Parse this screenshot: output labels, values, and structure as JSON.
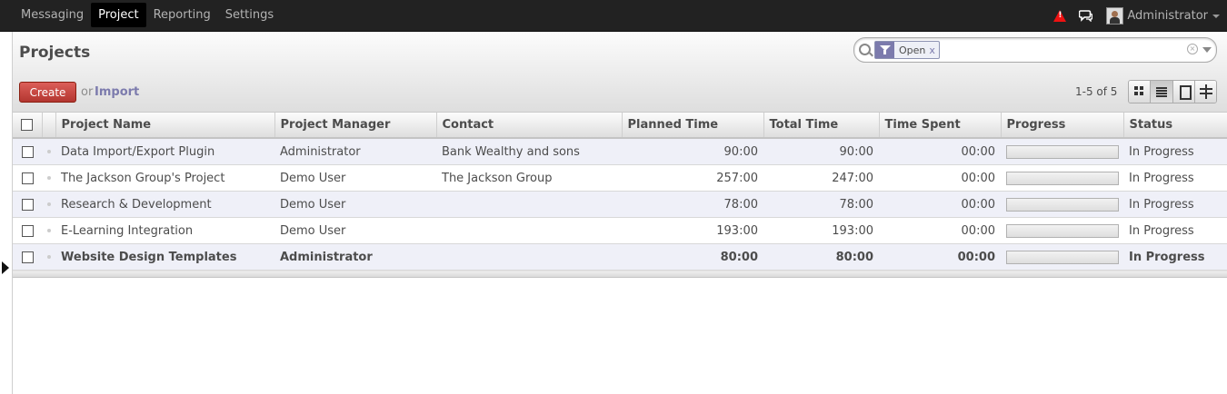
{
  "topbar": {
    "menu": [
      "Messaging",
      "Project",
      "Reporting",
      "Settings"
    ],
    "active_menu": "Project",
    "user": "Administrator"
  },
  "control_panel": {
    "title": "Projects",
    "search": {
      "facet_value": "Open",
      "facet_remove": "x"
    },
    "create_label": "Create",
    "or_label": "or",
    "import_label": "Import",
    "pager": "1-5 of 5"
  },
  "table": {
    "columns": [
      "Project Name",
      "Project Manager",
      "Contact",
      "Planned Time",
      "Total Time",
      "Time Spent",
      "Progress",
      "Status"
    ],
    "rows": [
      {
        "name": "Data Import/Export Plugin",
        "manager": "Administrator",
        "contact": "Bank Wealthy and sons",
        "planned": "90:00",
        "total": "90:00",
        "spent": "00:00",
        "progress": 0,
        "status": "In Progress"
      },
      {
        "name": "The Jackson Group's Project",
        "manager": "Demo User",
        "contact": "The Jackson Group",
        "planned": "257:00",
        "total": "247:00",
        "spent": "00:00",
        "progress": 0,
        "status": "In Progress"
      },
      {
        "name": "Research & Development",
        "manager": "Demo User",
        "contact": "",
        "planned": "78:00",
        "total": "78:00",
        "spent": "00:00",
        "progress": 0,
        "status": "In Progress"
      },
      {
        "name": "E-Learning Integration",
        "manager": "Demo User",
        "contact": "",
        "planned": "193:00",
        "total": "193:00",
        "spent": "00:00",
        "progress": 0,
        "status": "In Progress"
      },
      {
        "name": "Website Design Templates",
        "manager": "Administrator",
        "contact": "",
        "planned": "80:00",
        "total": "80:00",
        "spent": "00:00",
        "progress": 0,
        "status": "In Progress"
      }
    ]
  },
  "colors": {
    "accent": "#7c7bad",
    "create": "#c2413b",
    "topbar": "#222222",
    "row_alt": "#eff0f8"
  }
}
